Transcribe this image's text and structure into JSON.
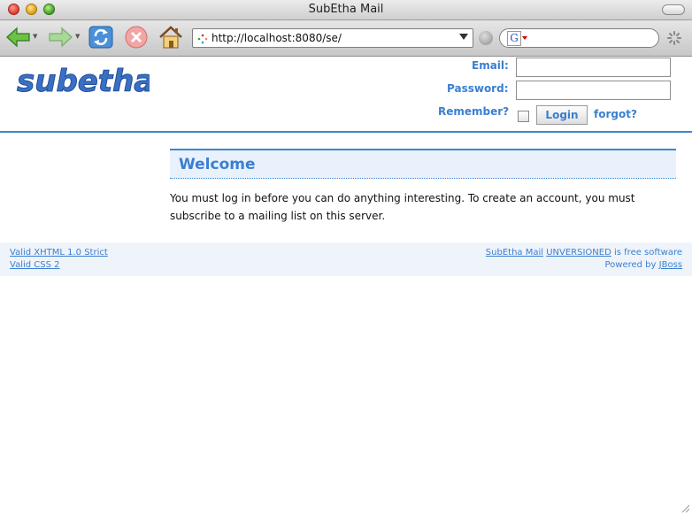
{
  "window": {
    "title": "SubEtha Mail"
  },
  "toolbar": {
    "back_icon": "back-arrow-icon",
    "forward_icon": "forward-arrow-icon",
    "reload_icon": "reload-icon",
    "stop_icon": "stop-icon",
    "home_icon": "home-icon",
    "url": "http://localhost:8080/se/",
    "search_value": "",
    "search_engine_icon": "google-icon",
    "search_engine_glyph": "G"
  },
  "brand": {
    "logo_text": "subetha",
    "logo_color": "#3a6fc4"
  },
  "login": {
    "email_label": "Email:",
    "email_value": "",
    "password_label": "Password:",
    "password_value": "",
    "remember_label": "Remember?",
    "remember_checked": false,
    "login_button": "Login",
    "forgot_link": "forgot?"
  },
  "main": {
    "heading": "Welcome",
    "intro": "You must log in before you can do anything interesting. To create an account, you must subscribe to a mailing list on this server."
  },
  "footer": {
    "valid_xhtml": "Valid XHTML 1.0 Strict",
    "valid_css": "Valid CSS 2",
    "product_link": "SubEtha Mail",
    "version_link": "UNVERSIONED",
    "free_software_text": "is free software",
    "powered_by_text": "Powered by",
    "jboss_link": "JBoss"
  },
  "colors": {
    "accent": "#3a7fd0",
    "header_rule": "#3d86cf",
    "welcome_bg": "#e9f1fd",
    "footer_bg": "#eff4fb"
  }
}
